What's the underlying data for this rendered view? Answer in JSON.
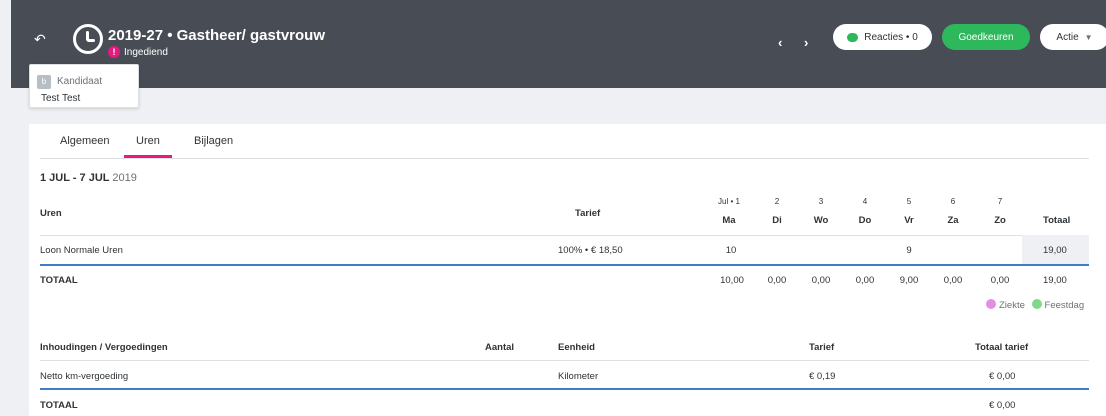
{
  "header": {
    "title": "2019-27 • Gastheer/ gastvrouw",
    "status": "Ingediend",
    "status_icon": "!",
    "reactions": "Reacties • 0",
    "approve": "Goedkeuren",
    "action": "Actie",
    "colors": {
      "bg": "#474c55",
      "approve": "#2eb85c",
      "status": "#e5197e"
    }
  },
  "candidate": {
    "badge": "b",
    "label": "Kandidaat",
    "name": "Test Test"
  },
  "tabs": [
    "Algemeen",
    "Uren",
    "Bijlagen"
  ],
  "active_tab": "Uren",
  "week": {
    "range": "1 JUL - 7 JUL",
    "year": "2019"
  },
  "hours": {
    "col_uren": "Uren",
    "col_tarief": "Tarief",
    "col_totaal": "Totaal",
    "dates": [
      "Jul • 1",
      "2",
      "3",
      "4",
      "5",
      "6",
      "7"
    ],
    "days": [
      "Ma",
      "Di",
      "Wo",
      "Do",
      "Vr",
      "Za",
      "Zo"
    ],
    "row": {
      "label": "Loon Normale Uren",
      "tarief": "100% • € 18,50",
      "values": [
        "10",
        "",
        "",
        "",
        "9",
        "",
        ""
      ],
      "total": "19,00"
    },
    "totals": {
      "label": "TOTAAL",
      "values": [
        "10,00",
        "0,00",
        "0,00",
        "0,00",
        "9,00",
        "0,00",
        "0,00"
      ],
      "total": "19,00"
    }
  },
  "legend": {
    "sick": "Ziekte",
    "holiday": "Feestdag",
    "sick_color": "#e08ee6",
    "holiday_color": "#7fd98a"
  },
  "deductions": {
    "col_label": "Inhoudingen / Vergoedingen",
    "col_aantal": "Aantal",
    "col_eenheid": "Eenheid",
    "col_tarief": "Tarief",
    "col_totaal": "Totaal tarief",
    "row": {
      "label": "Netto km-vergoeding",
      "eenheid": "Kilometer",
      "tarief": "€ 0,19",
      "total": "€ 0,00"
    },
    "totals": {
      "label": "TOTAAL",
      "total": "€ 0,00"
    }
  }
}
